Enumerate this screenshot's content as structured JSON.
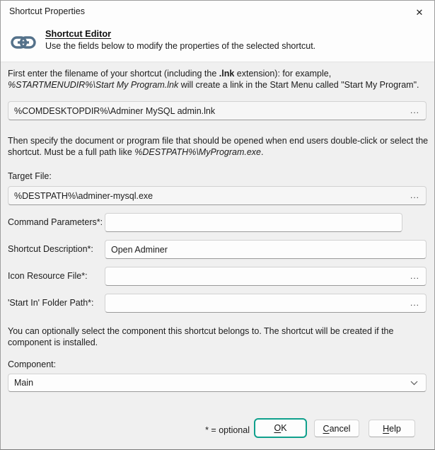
{
  "window": {
    "title": "Shortcut Properties",
    "close_glyph": "✕"
  },
  "header": {
    "title": "Shortcut Editor",
    "subtitle": "Use the fields below to modify the properties of the selected shortcut."
  },
  "intro": {
    "pre": "First enter the filename of your shortcut (including the ",
    "bold": ".lnk",
    "mid": " extension): for example, ",
    "italic": "%STARTMENUDIR%\\Start My Program.lnk",
    "post": " will create a link in the Start Menu called \"Start My Program\"."
  },
  "filename_field": {
    "value": "%COMDESKTOPDIR%\\Adminer MySQL admin.lnk",
    "browse_label": "..."
  },
  "target_intro": {
    "pre": "Then specify the document or program file that should be opened when end users double-click or select the shortcut. Must be a full path like ",
    "italic": "%DESTPATH%\\MyProgram.exe",
    "post": "."
  },
  "target_file": {
    "label": "Target File:",
    "value": "%DESTPATH%\\adminer-mysql.exe",
    "browse_label": "..."
  },
  "fields": {
    "command_parameters": {
      "label": "Command Parameters*:",
      "value": ""
    },
    "shortcut_description": {
      "label": "Shortcut Description*:",
      "value": "Open Adminer"
    },
    "icon_resource_file": {
      "label": "Icon Resource File*:",
      "value": "",
      "browse_label": "..."
    },
    "start_in_folder": {
      "label": "'Start In' Folder Path*:",
      "value": "",
      "browse_label": "..."
    }
  },
  "component_section": {
    "text": "You can optionally select the component this shortcut belongs to. The shortcut will be created if the component is installed.",
    "label": "Component:",
    "selected_value": "Main"
  },
  "footer": {
    "optional_note": "* = optional",
    "ok_mnemonic": "O",
    "ok_rest": "K",
    "cancel_mnemonic": "C",
    "cancel_rest": "ancel",
    "help_mnemonic": "H",
    "help_rest": "elp"
  },
  "colors": {
    "accent": "#0FA08C",
    "icon": "#54718A",
    "dialog_background": "#F0F0F0",
    "header_background": "#FDFDFD"
  }
}
